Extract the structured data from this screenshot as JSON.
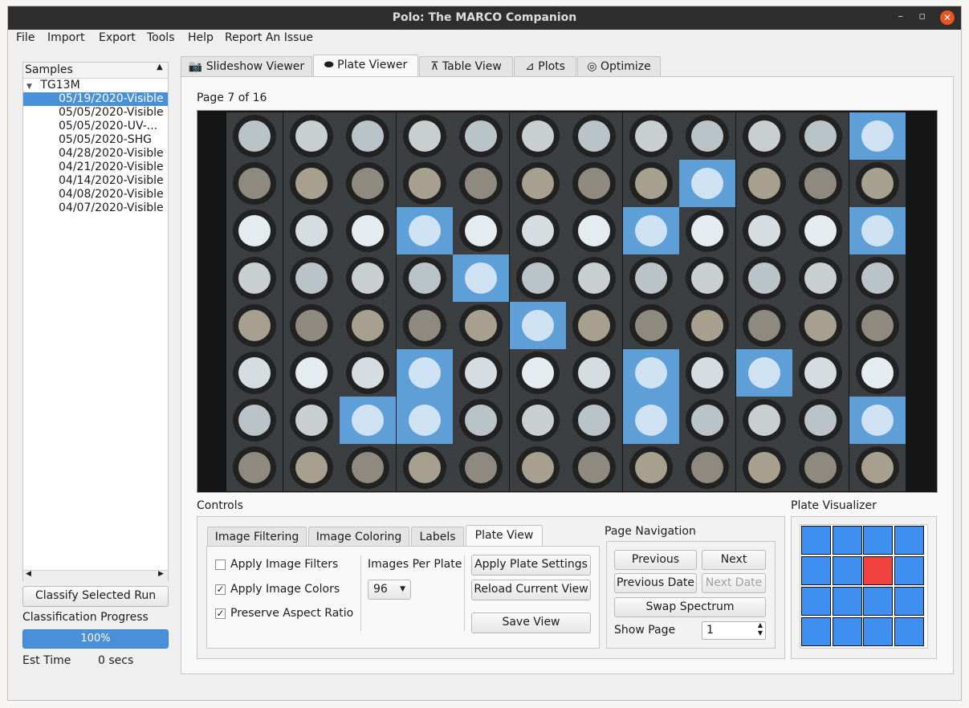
{
  "window": {
    "title": "Polo: The MARCO Companion",
    "min": "–",
    "max": "▫",
    "close": "✕"
  },
  "menu": [
    "File",
    "Import",
    "Export",
    "Tools",
    "Help",
    "Report An Issue"
  ],
  "sidebar": {
    "header": "Samples",
    "run": "TG13M",
    "items": [
      "05/19/2020-Visible",
      "05/05/2020-Visible",
      "05/05/2020-UV-...",
      "05/05/2020-SHG",
      "04/28/2020-Visible",
      "04/21/2020-Visible",
      "04/14/2020-Visible",
      "04/08/2020-Visible",
      "04/07/2020-Visible"
    ],
    "selected_index": 0,
    "classify_button": "Classify Selected Run",
    "progress_label": "Classification Progress",
    "progress_value": 1.0,
    "progress_text": "100%",
    "est_time_label": "Est Time",
    "est_time_value": "0 secs"
  },
  "main_tabs": [
    {
      "label": "Slideshow Viewer",
      "icon": "camera-icon"
    },
    {
      "label": "Plate Viewer",
      "icon": "eye-icon"
    },
    {
      "label": "Table View",
      "icon": "table-icon"
    },
    {
      "label": "Plots",
      "icon": "chart-icon"
    },
    {
      "label": "Optimize",
      "icon": "target-icon"
    }
  ],
  "active_tab": 1,
  "plate_viewer": {
    "page_label": "Page 7 of 16",
    "rows": 8,
    "cols": 12,
    "highlighted": [
      [
        0,
        11
      ],
      [
        1,
        8
      ],
      [
        2,
        3
      ],
      [
        2,
        7
      ],
      [
        2,
        11
      ],
      [
        3,
        4
      ],
      [
        4,
        5
      ],
      [
        5,
        3
      ],
      [
        5,
        7
      ],
      [
        5,
        9
      ],
      [
        6,
        2
      ],
      [
        6,
        3
      ],
      [
        6,
        7
      ],
      [
        6,
        11
      ]
    ]
  },
  "controls": {
    "title": "Controls",
    "tabs": [
      "Image Filtering",
      "Image Coloring",
      "Labels",
      "Plate View"
    ],
    "active_tab": 3,
    "checkboxes": [
      {
        "label": "Apply Image Filters",
        "checked": false
      },
      {
        "label": "Apply Image Colors",
        "checked": true
      },
      {
        "label": "Preserve Aspect Ratio",
        "checked": true
      }
    ],
    "images_per_plate_label": "Images Per Plate",
    "images_per_plate_value": "96",
    "apply_button": "Apply Plate Settings",
    "reload_button": "Reload Current View",
    "save_button": "Save View"
  },
  "page_navigation": {
    "title": "Page Navigation",
    "previous": "Previous",
    "next": "Next",
    "previous_date": "Previous Date",
    "next_date": "Next Date",
    "swap": "Swap Spectrum",
    "show_page_label": "Show Page",
    "show_page_value": "1"
  },
  "visualizer": {
    "title": "Plate Visualizer",
    "rows": 4,
    "cols": 4,
    "active_cell": [
      1,
      2
    ],
    "cell_color": "#3f8ff0",
    "active_color": "#f04040"
  }
}
